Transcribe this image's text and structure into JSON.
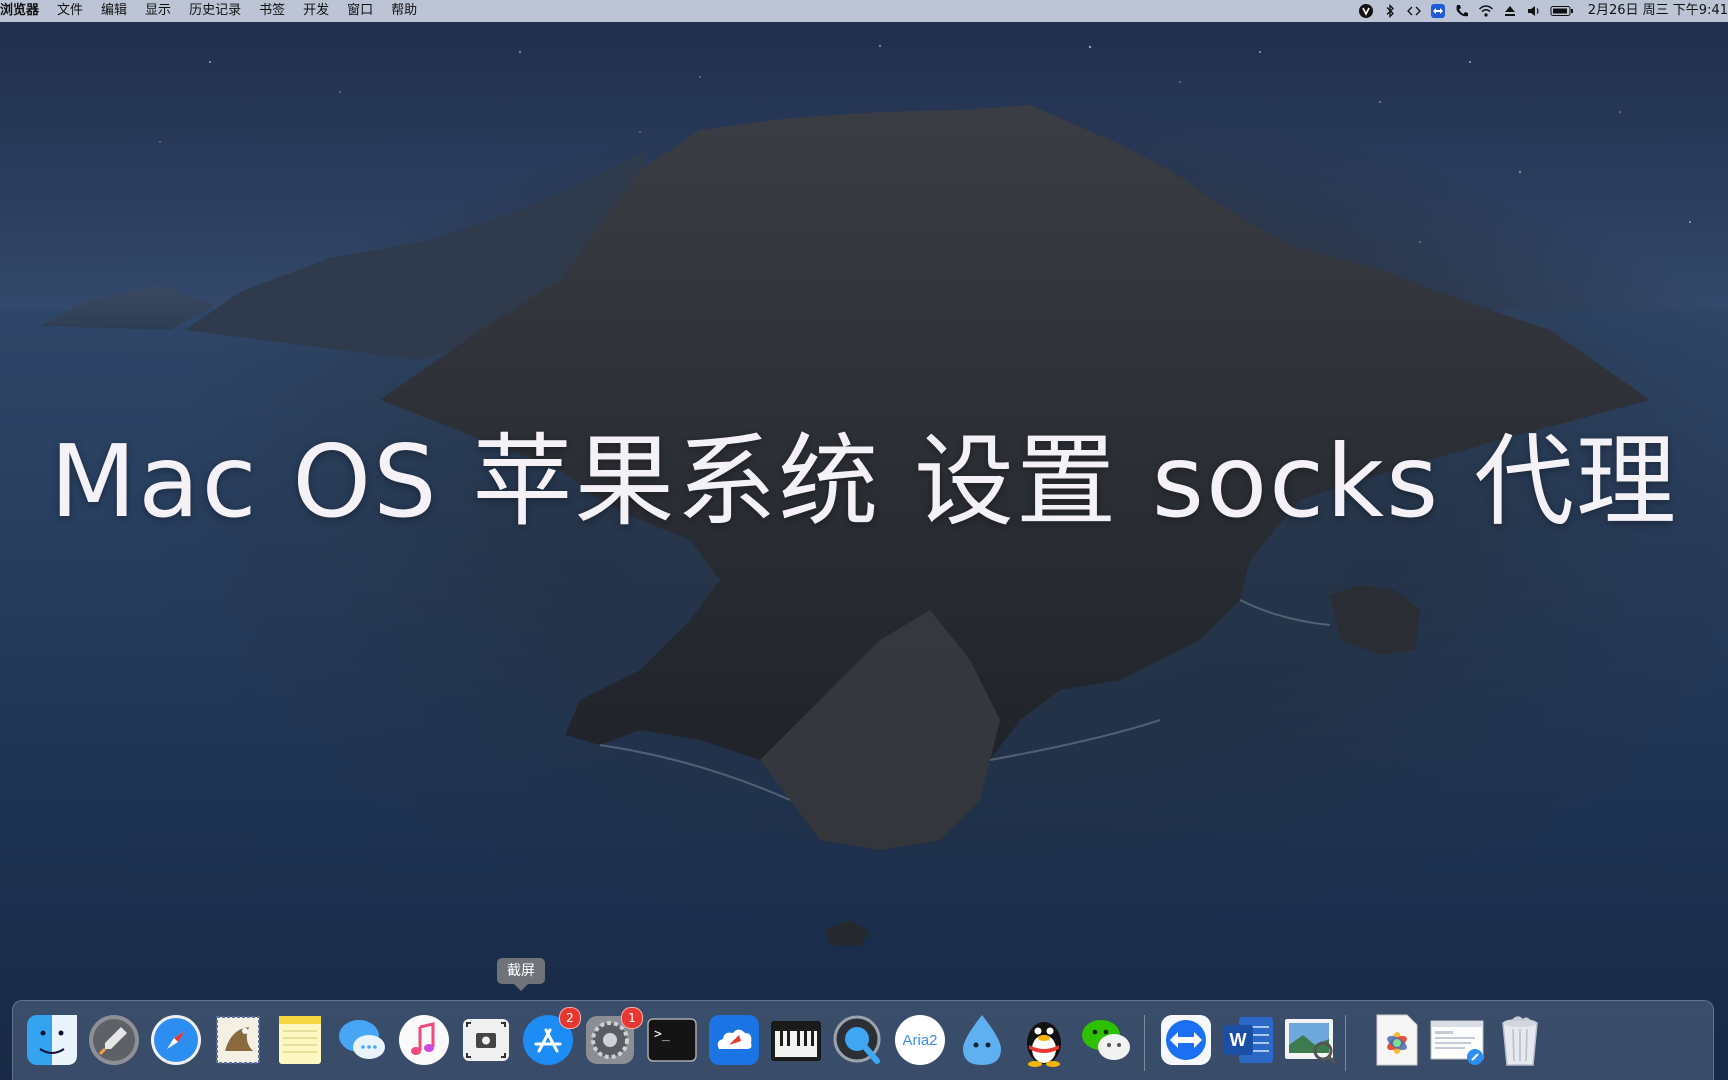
{
  "menubar": {
    "app_name": "浏览器",
    "items": [
      "文件",
      "编辑",
      "显示",
      "历史记录",
      "书签",
      "开发",
      "窗口",
      "帮助"
    ],
    "tray_icons": [
      "vpn-icon",
      "bluetooth-icon",
      "code-icon",
      "teamviewer-tray-icon",
      "phone-icon",
      "wifi-icon",
      "eject-icon",
      "volume-icon",
      "battery-icon"
    ],
    "clock": "2月26日 周三 下午9:41"
  },
  "overlay_title": "Mac OS 苹果系统 设置 socks 代理",
  "dock": {
    "tooltip": "截屏",
    "badges": {
      "app_store": "2",
      "system_preferences": "1"
    },
    "items": [
      {
        "id": "finder",
        "icon": "finder-icon",
        "running": true
      },
      {
        "id": "launchpad",
        "icon": "launchpad-icon",
        "running": false
      },
      {
        "id": "safari",
        "icon": "safari-icon",
        "running": true
      },
      {
        "id": "mail",
        "icon": "mail-icon",
        "running": false
      },
      {
        "id": "notes",
        "icon": "notes-icon",
        "running": false
      },
      {
        "id": "messages",
        "icon": "messages-icon",
        "running": false
      },
      {
        "id": "music",
        "icon": "music-icon",
        "running": false
      },
      {
        "id": "screenshot",
        "icon": "screenshot-icon",
        "running": false
      },
      {
        "id": "app-store",
        "icon": "app-store-icon",
        "running": false
      },
      {
        "id": "system-preferences",
        "icon": "gear-icon",
        "running": false
      },
      {
        "id": "terminal",
        "icon": "terminal-icon",
        "running": false
      },
      {
        "id": "cloud-app",
        "icon": "cloud-icon",
        "running": false
      },
      {
        "id": "piano",
        "icon": "piano-icon",
        "running": false
      },
      {
        "id": "quicktime",
        "icon": "quicktime-icon",
        "running": false
      },
      {
        "id": "aria2",
        "icon": "aria2-icon",
        "running": false
      },
      {
        "id": "droplet-app",
        "icon": "droplet-icon",
        "running": false
      },
      {
        "id": "qq",
        "icon": "qq-penguin-icon",
        "running": false
      },
      {
        "id": "wechat",
        "icon": "wechat-icon",
        "running": false
      },
      {
        "id": "teamviewer",
        "icon": "teamviewer-icon",
        "running": true
      },
      {
        "id": "word",
        "icon": "word-icon",
        "running": true
      },
      {
        "id": "preview",
        "icon": "preview-icon",
        "running": false
      },
      {
        "id": "photos-doc",
        "icon": "photos-document-icon",
        "running": false
      },
      {
        "id": "safari-downloads",
        "icon": "downloads-stack-icon",
        "running": false
      },
      {
        "id": "trash",
        "icon": "trash-icon",
        "running": false
      }
    ],
    "labels": {
      "aria2": "Aria2",
      "word": "W",
      "terminal": ">_"
    }
  },
  "colors": {
    "menubar": "#d2dae8",
    "badge": "#e8372f",
    "tooltip": "#6f7379",
    "title_text": "#f4f2f6"
  }
}
